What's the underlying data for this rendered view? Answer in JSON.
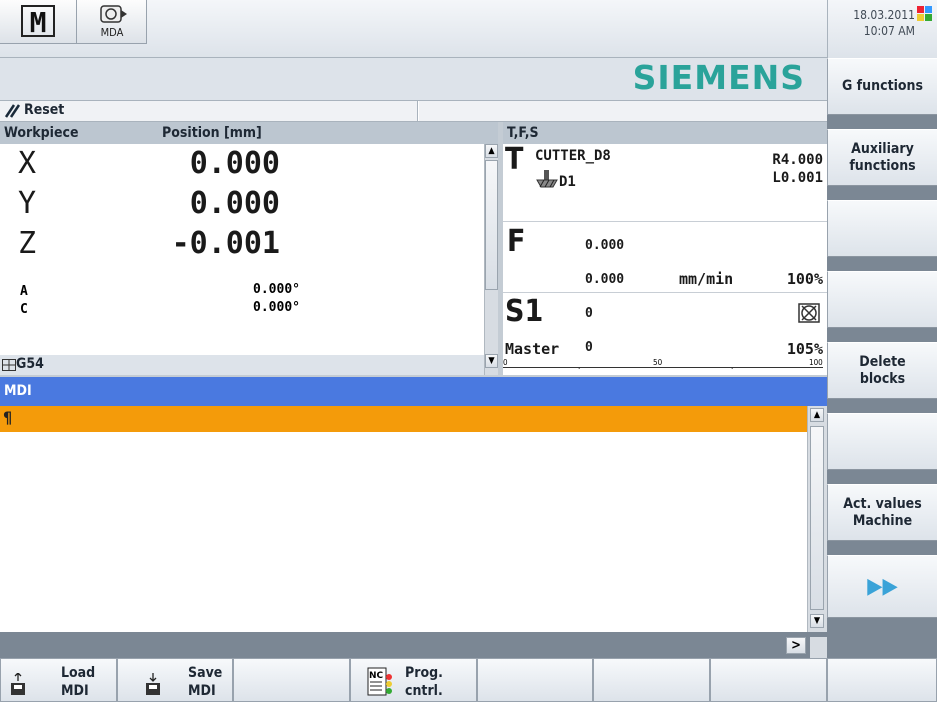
{
  "header": {
    "m_icon_label": "M",
    "mda_label": "MDA",
    "date": "18.03.2011",
    "time": "10:07 AM",
    "brand": "SIEMENS"
  },
  "status": {
    "reset_label": "Reset"
  },
  "workpiece": {
    "col1": "Workpiece",
    "col2": "Position [mm]",
    "axes": [
      {
        "name": "X",
        "value": "0.000"
      },
      {
        "name": "Y",
        "value": "0.000"
      },
      {
        "name": "Z",
        "value": "-0.001"
      },
      {
        "name": "A",
        "value": "0.000°"
      },
      {
        "name": "C",
        "value": "0.000°"
      }
    ],
    "frame": "G54"
  },
  "tfs": {
    "title": "T,F,S",
    "t_letter": "T",
    "tool_name": "CUTTER_D8",
    "tool_r": "R4.000",
    "tool_l": "L0.001",
    "tool_d": "D1",
    "f_letter": "F",
    "f_value1": "0.000",
    "f_value2": "0.000",
    "f_unit": "mm/min",
    "f_override": "100%",
    "s_letter": "S1",
    "s_value": "0",
    "master_label": "Master",
    "master_value": "0",
    "s_override": "105%",
    "scale": [
      "0",
      "50",
      "100"
    ]
  },
  "mdi": {
    "title": "MDI",
    "cursor_symbol": "¶"
  },
  "softkeys_right": [
    {
      "label": "G functions"
    },
    {
      "label": "Auxiliary functions"
    },
    {
      "label": ""
    },
    {
      "label": ""
    },
    {
      "label": "Delete blocks"
    },
    {
      "label": ""
    },
    {
      "label": "Act. values Machine"
    },
    {
      "label": "▶▶"
    }
  ],
  "softkeys_bottom": [
    {
      "label1": "Load",
      "label2": "MDI"
    },
    {
      "label1": "Save",
      "label2": "MDI"
    },
    {
      "label1": "",
      "label2": ""
    },
    {
      "label1": "Prog.",
      "label2": "cntrl."
    },
    {
      "label1": "",
      "label2": ""
    },
    {
      "label1": "",
      "label2": ""
    },
    {
      "label1": "",
      "label2": ""
    },
    {
      "label1": "",
      "label2": ""
    }
  ],
  "hscroll_arrow": ">"
}
